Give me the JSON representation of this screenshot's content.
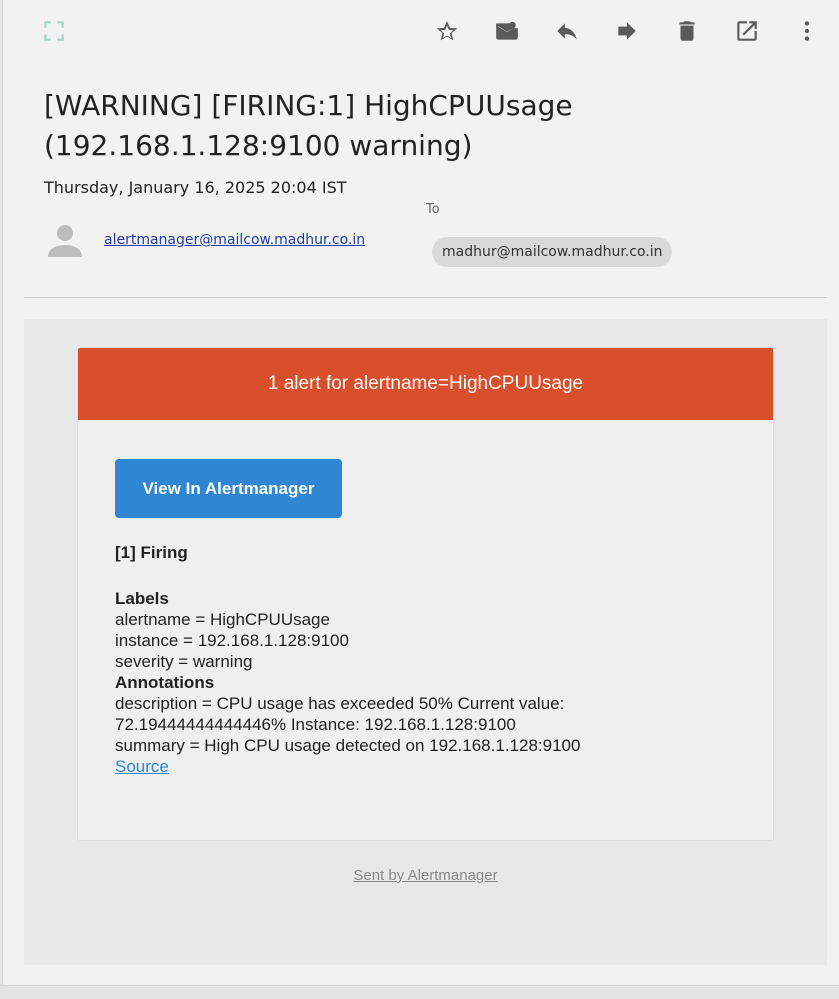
{
  "toolbar": {
    "icons": [
      "expand-icon",
      "star-icon",
      "mark-unread-icon",
      "reply-icon",
      "forward-icon",
      "delete-icon",
      "open-external-icon",
      "more-vert-icon"
    ],
    "icon_color": "#5a5a5a",
    "expand_color": "#9fd6c7"
  },
  "message": {
    "subject": "[WARNING] [FIRING:1] HighCPUUsage (192.168.1.128:9100 warning)",
    "date": "Thursday, January 16, 2025 20:04 IST",
    "from": "alertmanager@mailcow.madhur.co.in",
    "to_label": "To",
    "to": "madhur@mailcow.madhur.co.in"
  },
  "email": {
    "header": "1 alert for alertname=HighCPUUsage",
    "header_color": "#da4f2b",
    "button_label": "View In Alertmanager",
    "button_color": "#2f86d3",
    "firing": "[1] Firing",
    "labels_heading": "Labels",
    "labels": [
      "alertname = HighCPUUsage",
      "instance = 192.168.1.128:9100",
      "severity = warning"
    ],
    "annotations_heading": "Annotations",
    "annotations": [
      "description = CPU usage has exceeded 50% Current value: 72.19444444444446% Instance: 192.168.1.128:9100",
      "summary = High CPU usage detected on 192.168.1.128:9100"
    ],
    "source_link": "Source",
    "footer": "Sent by Alertmanager"
  }
}
